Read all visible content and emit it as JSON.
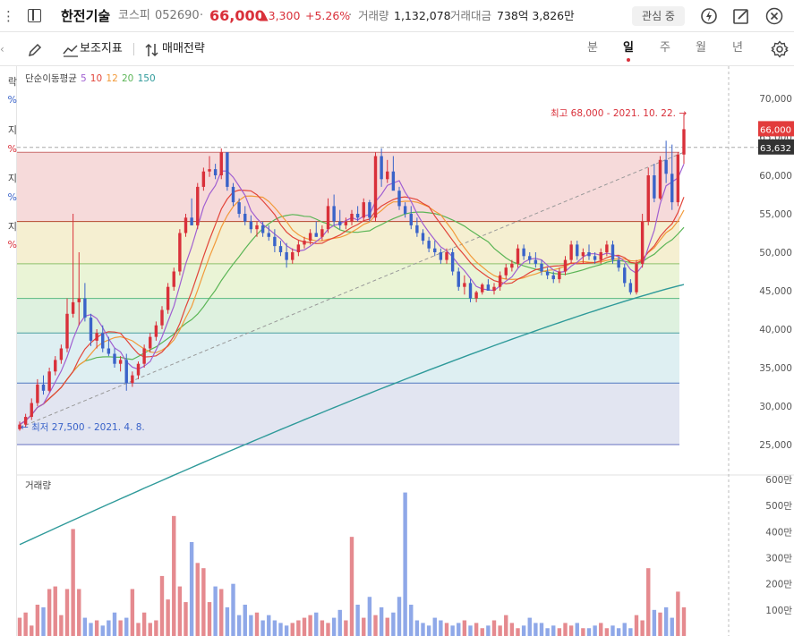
{
  "header": {
    "name": "한전기술",
    "market": "코스피",
    "code": "052690",
    "price": "66,000",
    "change": "▲3,300",
    "change_pct": "+5.26%",
    "volume_label": "거래량",
    "volume": "1,132,078",
    "turnover_label": "거래대금",
    "turnover": "738억 3,826만",
    "watch_button": "관심 중"
  },
  "toolbar": {
    "indicator_label": "보조지표",
    "strategy_label": "매매전략",
    "periods": [
      "분",
      "일",
      "주",
      "월",
      "년"
    ],
    "selected_period": "일"
  },
  "left_strip": {
    "fragments": [
      "락",
      "%",
      "지",
      "%",
      "지",
      "%",
      "지",
      "%"
    ]
  },
  "colors": {
    "up": "#d9303a",
    "down": "#3a63c9",
    "ma5": "#a05fd1",
    "ma10": "#e2453a",
    "ma12": "#f29a3a",
    "ma20": "#5bb556",
    "ma150": "#2f9a9a"
  },
  "chart_data": {
    "type": "candlestick",
    "ma_legend": {
      "title": "단순이동평균",
      "periods": [
        "5",
        "10",
        "12",
        "20",
        "150"
      ]
    },
    "price_axis_labels": [
      "70,000",
      "65,000",
      "60,000",
      "55,000",
      "50,000",
      "45,000",
      "40,000",
      "35,000",
      "30,000",
      "25,000"
    ],
    "ylim": [
      23000,
      72000
    ],
    "current_price_tag": "66,000",
    "crosshair_price_tag": "63,632",
    "high_annotation": "최고 68,000 - 2021. 10. 22.",
    "low_annotation": "최저 27,500 - 2021. 4. 8.",
    "fibonacci_levels": [
      63000,
      54000,
      48500,
      44000,
      39500,
      33000,
      25000
    ],
    "candles": [
      [
        27,
        28,
        26.8,
        27.6
      ],
      [
        27.6,
        29,
        27.2,
        28.6
      ],
      [
        28.6,
        31,
        28.2,
        30.4
      ],
      [
        30.4,
        33.5,
        30,
        32.8
      ],
      [
        32.8,
        34,
        31.5,
        32
      ],
      [
        32,
        35,
        31.8,
        34.5
      ],
      [
        34.5,
        36.5,
        34,
        36
      ],
      [
        36,
        38,
        35.5,
        37.5
      ],
      [
        37.5,
        44,
        37,
        42
      ],
      [
        42,
        55,
        41.5,
        43.5
      ],
      [
        43.5,
        50,
        40.5,
        44
      ],
      [
        44,
        46,
        41,
        41.5
      ],
      [
        41.5,
        42,
        37.8,
        38.5
      ],
      [
        38.5,
        40,
        37.5,
        39.5
      ],
      [
        39.5,
        40.5,
        37,
        37.5
      ],
      [
        37.5,
        39,
        36.5,
        36.8
      ],
      [
        36.8,
        37.5,
        35,
        35.5
      ],
      [
        35.5,
        36.5,
        34.5,
        36
      ],
      [
        36,
        36.8,
        32,
        33
      ],
      [
        33,
        34.5,
        32.5,
        34
      ],
      [
        34,
        35.8,
        33.5,
        35.5
      ],
      [
        35.5,
        38,
        35,
        37.5
      ],
      [
        37.5,
        39.5,
        37,
        39
      ],
      [
        39,
        41,
        38.5,
        40.5
      ],
      [
        40.5,
        43,
        40,
        42.5
      ],
      [
        42.5,
        46,
        42,
        45.5
      ],
      [
        45.5,
        48,
        45,
        47.5
      ],
      [
        47.5,
        53,
        47,
        52.5
      ],
      [
        52.5,
        55,
        52,
        54.5
      ],
      [
        54.5,
        57,
        53.5,
        53.5
      ],
      [
        53.5,
        59,
        53,
        58.5
      ],
      [
        58.5,
        61,
        58,
        60.5
      ],
      [
        60.5,
        62.5,
        59.8,
        60.8
      ],
      [
        60.8,
        61.5,
        59.5,
        60
      ],
      [
        60,
        63.5,
        59.5,
        63
      ],
      [
        63,
        62.5,
        58,
        58.5
      ],
      [
        58.5,
        59,
        56,
        56.5
      ],
      [
        56.5,
        57,
        54.5,
        55
      ],
      [
        55,
        56,
        53.5,
        54
      ],
      [
        54,
        54.8,
        52.5,
        53
      ],
      [
        53,
        54,
        52,
        53.5
      ],
      [
        53.5,
        54,
        52,
        52.5
      ],
      [
        52.5,
        53.5,
        51.5,
        52
      ],
      [
        52,
        53,
        50,
        50.8
      ],
      [
        50.8,
        51.5,
        49.5,
        50
      ],
      [
        50,
        51.2,
        48,
        49
      ],
      [
        49,
        50.5,
        48.5,
        50
      ],
      [
        50,
        51.5,
        49.5,
        51
      ],
      [
        51,
        52,
        50.5,
        51.5
      ],
      [
        51.5,
        53,
        51,
        52.5
      ],
      [
        52.5,
        54,
        52,
        52
      ],
      [
        52,
        53.5,
        51.5,
        53
      ],
      [
        53,
        57,
        52.5,
        56
      ],
      [
        56,
        57.5,
        53.5,
        54
      ],
      [
        54,
        55.5,
        53,
        53.5
      ],
      [
        53.5,
        54.5,
        53,
        54
      ],
      [
        54,
        55.5,
        53.5,
        55
      ],
      [
        55,
        56,
        54,
        54.5
      ],
      [
        54.5,
        57,
        54,
        56.5
      ],
      [
        56.5,
        56.8,
        54,
        54.5
      ],
      [
        54.5,
        63,
        54,
        62.5
      ],
      [
        62.5,
        63.5,
        58.5,
        59.5
      ],
      [
        59.5,
        62,
        59,
        60.5
      ],
      [
        60.5,
        62.5,
        59.5,
        58
      ],
      [
        58,
        58.5,
        55.5,
        56
      ],
      [
        56,
        56.5,
        54.5,
        55
      ],
      [
        55,
        56,
        53,
        53.5
      ],
      [
        53.5,
        54.5,
        52,
        52.5
      ],
      [
        52.5,
        53,
        51,
        51.5
      ],
      [
        51.5,
        52,
        50,
        50.5
      ],
      [
        50.5,
        51.5,
        49.5,
        50
      ],
      [
        50,
        50.5,
        48.5,
        49
      ],
      [
        49,
        50.5,
        48.5,
        50
      ],
      [
        50,
        50.5,
        47,
        47.5
      ],
      [
        47.5,
        48,
        45,
        45.5
      ],
      [
        45.5,
        47,
        44.5,
        46
      ],
      [
        46,
        46.5,
        43.5,
        44
      ],
      [
        44,
        45,
        43.5,
        44.8
      ],
      [
        44.8,
        46,
        44.5,
        45.8
      ],
      [
        45.8,
        46.5,
        45,
        45
      ],
      [
        45,
        46,
        44.5,
        45.5
      ],
      [
        45.5,
        47.5,
        45,
        47
      ],
      [
        47,
        48.5,
        46.5,
        48
      ],
      [
        48,
        49,
        47.5,
        48.5
      ],
      [
        48.5,
        51,
        48,
        50.5
      ],
      [
        50.5,
        51,
        49,
        49.5
      ],
      [
        49.5,
        50,
        48.5,
        49
      ],
      [
        49,
        50,
        48,
        48.5
      ],
      [
        48.5,
        49,
        47,
        47.5
      ],
      [
        47.5,
        48,
        46.5,
        47
      ],
      [
        47,
        47.5,
        46,
        46.5
      ],
      [
        46.5,
        48,
        46,
        47.5
      ],
      [
        47.5,
        49.5,
        47,
        49
      ],
      [
        49,
        51.5,
        48.5,
        51
      ],
      [
        51,
        51.5,
        49,
        49.5
      ],
      [
        49.5,
        50.5,
        48.5,
        50
      ],
      [
        50,
        51,
        49,
        49.5
      ],
      [
        49.5,
        50,
        48.5,
        49
      ],
      [
        49,
        50.5,
        48.5,
        50
      ],
      [
        50,
        51.5,
        49.5,
        51
      ],
      [
        51,
        51.5,
        48.5,
        49
      ],
      [
        49,
        49.5,
        47.5,
        48
      ],
      [
        48,
        48.5,
        45.5,
        46
      ],
      [
        46,
        46.5,
        44.5,
        44.8
      ],
      [
        44.8,
        49,
        44.5,
        48.5
      ],
      [
        48.5,
        55,
        48,
        54
      ],
      [
        54,
        61,
        53.5,
        60
      ],
      [
        60,
        61.5,
        56.5,
        57
      ],
      [
        57,
        62.5,
        56.8,
        62
      ],
      [
        62,
        64.5,
        59,
        60.2
      ],
      [
        60.2,
        64,
        55.5,
        56.5
      ],
      [
        56.5,
        63,
        56,
        62.7
      ],
      [
        62.7,
        68,
        61.5,
        66
      ]
    ],
    "ma_values": {
      "ma5_start": 27.4,
      "ma5_end": 63.2,
      "ma150_start": 12.0,
      "ma150_end": 45.8
    },
    "volume_axis_labels": [
      "600만",
      "500만",
      "400만",
      "300만",
      "200만",
      "100만"
    ],
    "volume_label": "거래량",
    "volume_ylim": [
      0,
      6000000
    ],
    "volumes": [
      0.7,
      0.9,
      0.4,
      1.2,
      1.1,
      1.8,
      1.9,
      0.8,
      1.8,
      4.1,
      1.8,
      0.7,
      0.5,
      0.6,
      0.4,
      0.6,
      0.9,
      0.6,
      0.7,
      1.8,
      0.5,
      0.9,
      0.5,
      0.6,
      2.3,
      1.4,
      4.6,
      1.9,
      1.3,
      3.6,
      2.8,
      2.6,
      1.3,
      1.9,
      1.8,
      1.1,
      2.0,
      0.8,
      1.2,
      0.8,
      0.9,
      0.6,
      0.8,
      0.6,
      0.5,
      0.4,
      0.5,
      0.6,
      0.7,
      0.8,
      0.9,
      0.6,
      0.5,
      0.7,
      1.0,
      0.6,
      3.8,
      1.2,
      0.7,
      1.5,
      0.8,
      1.1,
      0.7,
      0.9,
      1.5,
      5.5,
      1.2,
      0.6,
      0.5,
      0.4,
      0.7,
      0.6,
      0.5,
      0.4,
      0.5,
      0.6,
      0.4,
      0.5,
      0.3,
      0.4,
      0.6,
      0.4,
      0.8,
      0.5,
      0.3,
      0.4,
      0.7,
      0.5,
      0.5,
      0.3,
      0.4,
      0.3,
      0.5,
      0.4,
      0.5,
      0.3,
      0.3,
      0.4,
      0.5,
      0.3,
      0.4,
      0.3,
      0.5,
      0.3,
      0.8,
      0.6,
      2.6,
      1.0,
      0.9,
      1.1,
      0.7,
      1.7,
      1.1
    ],
    "volume_unit": 1000000
  }
}
